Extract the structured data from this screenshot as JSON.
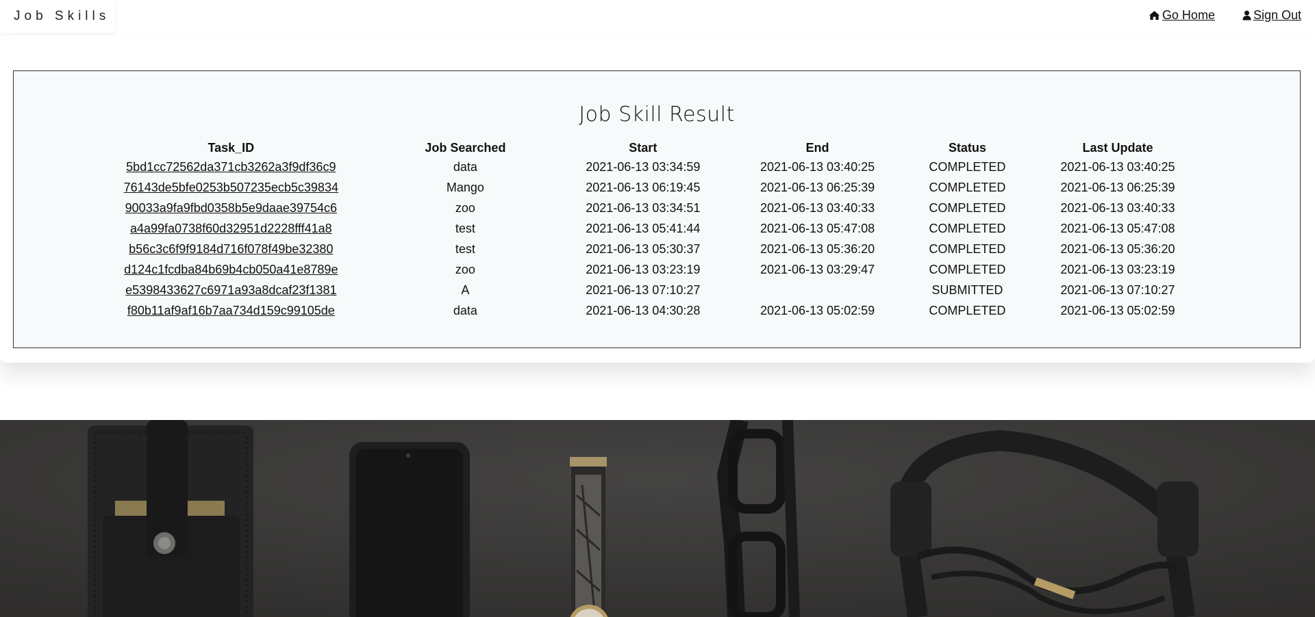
{
  "navbar": {
    "brand": "Job Skills",
    "go_home": "Go Home",
    "sign_out": "Sign Out"
  },
  "result": {
    "title": "Job Skill Result",
    "columns": [
      "Task_ID",
      "Job Searched",
      "Start",
      "End",
      "Status",
      "Last Update"
    ],
    "rows": [
      {
        "task_id": "5bd1cc72562da371cb3262a3f9df36c9",
        "job": "data",
        "start": "2021-06-13 03:34:59",
        "end": "2021-06-13 03:40:25",
        "status": "COMPLETED",
        "last_update": "2021-06-13 03:40:25"
      },
      {
        "task_id": "76143de5bfe0253b507235ecb5c39834",
        "job": "Mango",
        "start": "2021-06-13 06:19:45",
        "end": "2021-06-13 06:25:39",
        "status": "COMPLETED",
        "last_update": "2021-06-13 06:25:39"
      },
      {
        "task_id": "90033a9fa9fbd0358b5e9daae39754c6",
        "job": "zoo",
        "start": "2021-06-13 03:34:51",
        "end": "2021-06-13 03:40:33",
        "status": "COMPLETED",
        "last_update": "2021-06-13 03:40:33"
      },
      {
        "task_id": "a4a99fa0738f60d32951d2228fff41a8",
        "job": "test",
        "start": "2021-06-13 05:41:44",
        "end": "2021-06-13 05:47:08",
        "status": "COMPLETED",
        "last_update": "2021-06-13 05:47:08"
      },
      {
        "task_id": "b56c3c6f9f9184d716f078f49be32380",
        "job": "test",
        "start": "2021-06-13 05:30:37",
        "end": "2021-06-13 05:36:20",
        "status": "COMPLETED",
        "last_update": "2021-06-13 05:36:20"
      },
      {
        "task_id": "d124c1fcdba84b69b4cb050a41e8789e",
        "job": "zoo",
        "start": "2021-06-13 03:23:19",
        "end": "2021-06-13 03:29:47",
        "status": "COMPLETED",
        "last_update": "2021-06-13 03:23:19"
      },
      {
        "task_id": "e5398433627c6971a93a8dcaf23f1381",
        "job": "A",
        "start": "2021-06-13 07:10:27",
        "end": "",
        "status": "SUBMITTED",
        "last_update": "2021-06-13 07:10:27"
      },
      {
        "task_id": "f80b11af9af16b7aa734d159c99105de",
        "job": "data",
        "start": "2021-06-13 04:30:28",
        "end": "2021-06-13 05:02:59",
        "status": "COMPLETED",
        "last_update": "2021-06-13 05:02:59"
      }
    ]
  },
  "icons": {
    "home": "home-icon",
    "user": "user-icon"
  },
  "colors": {
    "result_bg": "#f7fafb",
    "hero_bg": "#3a3938"
  }
}
